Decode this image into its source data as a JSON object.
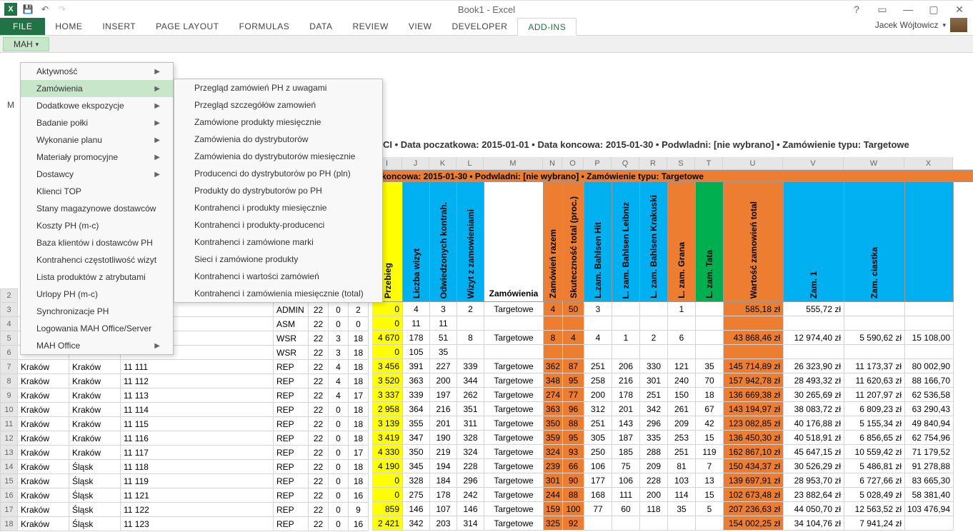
{
  "title": "Book1 - Excel",
  "user": "Jacek Wójtowicz",
  "ribbon": {
    "file": "FILE",
    "tabs": [
      "HOME",
      "INSERT",
      "PAGE LAYOUT",
      "FORMULAS",
      "DATA",
      "REVIEW",
      "VIEW",
      "DEVELOPER",
      "ADD-INS"
    ],
    "active": "ADD-INS"
  },
  "mah_btn": "MAH",
  "m_label": "M",
  "menu1": [
    {
      "label": "Aktywność",
      "arrow": true
    },
    {
      "label": "Zamówienia",
      "arrow": true,
      "hl": true
    },
    {
      "label": "Dodatkowe ekspozycje",
      "arrow": true
    },
    {
      "label": "Badanie połki",
      "arrow": true
    },
    {
      "label": "Wykonanie planu",
      "arrow": true
    },
    {
      "label": "Materiały promocyjne",
      "arrow": true
    },
    {
      "label": "Dostawcy",
      "arrow": true
    },
    {
      "label": "Klienci TOP",
      "arrow": false
    },
    {
      "label": "Stany magazynowe dostawców",
      "arrow": false
    },
    {
      "label": "Koszty PH (m-c)",
      "arrow": false
    },
    {
      "label": "Baza klientów i dostawców PH",
      "arrow": false
    },
    {
      "label": "Kontrahenci częstotliwość wizyt",
      "arrow": false
    },
    {
      "label": "Lista produktów z atrybutami",
      "arrow": false
    },
    {
      "label": "Urlopy PH (m-c)",
      "arrow": false
    },
    {
      "label": "Synchronizacje PH",
      "arrow": false
    },
    {
      "label": "Logowania MAH Office/Server",
      "arrow": false
    },
    {
      "label": "MAH Office",
      "arrow": true
    }
  ],
  "menu2": [
    "Przegląd zamówień PH z uwagami",
    "Przegląd szczegółów zamowień",
    "Zamówione produkty miesięcznie",
    "Zamówienia do dystrybutorów",
    "Zamówienia do dystrybutorów miesięcznie",
    "Producenci do dystrybutorów po PH (pln)",
    "Produkty do dystrybutorów po PH",
    "Kontrahenci i  produkty miesięcznie",
    "Kontrahenci i produkty-producenci",
    "Kontrahenci i zamówione marki",
    "Sieci i zamówione produkty",
    "Kontrahenci i wartości zamówień",
    "Kontrahenci i zamówienia miesięcznie (total)"
  ],
  "info_row": "CI • Data poczatkowa: 2015-01-01 • Data koncowa: 2015-01-30 • Podwladni: [nie wybrano] • Zamówienie typu: Targetowe",
  "banner": "a koncowa: 2015-01-30 • Podwladni: [nie wybrano] • Zamówienie typu: Targetowe",
  "col_letters": [
    "I",
    "J",
    "K",
    "L",
    "M",
    "N",
    "O",
    "P",
    "Q",
    "R",
    "S",
    "T",
    "U",
    "V",
    "W",
    "X"
  ],
  "col_letter_widths": [
    43,
    38,
    38,
    38,
    83,
    27,
    30,
    39,
    39,
    39,
    39,
    39,
    84,
    85,
    85,
    68
  ],
  "row_nums": [
    "2",
    "3",
    "4",
    "5",
    "6",
    "7",
    "8",
    "9",
    "10",
    "11",
    "12",
    "13",
    "14",
    "15",
    "16",
    "17",
    "18"
  ],
  "hdr_cols": [
    {
      "label": "Przebieg",
      "cls": "w-prz",
      "vert": true
    },
    {
      "label": "Liczba wizyt",
      "cls": "w-lw",
      "vert": true
    },
    {
      "label": "Odwiedzonych kontrah.",
      "cls": "w-ok",
      "vert": true
    },
    {
      "label": "Wizyt z zamowieniami",
      "cls": "w-wz",
      "vert": true
    },
    {
      "label": "Zamówienia",
      "cls": "w-zam",
      "vert": false
    },
    {
      "label": "Zamówień razem",
      "cls": "w-zr",
      "vert": true
    },
    {
      "label": "Skuteczność total (proc.)",
      "cls": "w-sk",
      "vert": true
    },
    {
      "label": "L.zam. Bahlsen Hit",
      "cls": "w-bh",
      "vert": true
    },
    {
      "label": "L. zam. Bahlsen Leibniz",
      "cls": "w-bl",
      "vert": true
    },
    {
      "label": "L. zam. Bahlsen Krakuski",
      "cls": "w-bk",
      "vert": true
    },
    {
      "label": "L. zam. Grana",
      "cls": "w-gr",
      "vert": true
    },
    {
      "label": "L. zam. Tata",
      "cls": "w-ta",
      "vert": true
    },
    {
      "label": "Wartość zamowień total",
      "cls": "w-wt",
      "vert": true
    },
    {
      "label": "Zam. 1",
      "cls": "w-z1",
      "vert": true
    },
    {
      "label": "Zam. ciastka",
      "cls": "w-z2",
      "vert": true
    },
    {
      "label": "",
      "cls": "w-z3",
      "vert": false
    }
  ],
  "rows": [
    {
      "reg": "",
      "sub": "",
      "zip": "",
      "role": "ADMIN",
      "a": "22",
      "b": "0",
      "c": "2",
      "prz": "0",
      "lw": "4",
      "ok": "3",
      "wz": "2",
      "zam": "Targetowe",
      "zr": "4",
      "sk": "50",
      "bh": "3",
      "bl": "",
      "bk": "",
      "gr": "1",
      "ta": "",
      "wt": "585,18 zł",
      "z1": "555,72 zł",
      "z2": "",
      "z3": ""
    },
    {
      "reg": "",
      "sub": "",
      "zip": "",
      "role": "ASM",
      "a": "22",
      "b": "0",
      "c": "0",
      "prz": "0",
      "lw": "11",
      "ok": "11",
      "wz": "",
      "zam": "",
      "zr": "",
      "sk": "",
      "bh": "",
      "bl": "",
      "bk": "",
      "gr": "",
      "ta": "",
      "wt": "",
      "z1": "",
      "z2": "",
      "z3": ""
    },
    {
      "reg": "",
      "sub": "",
      "zip": "",
      "role": "WSR",
      "a": "22",
      "b": "3",
      "c": "18",
      "prz": "4 670",
      "lw": "178",
      "ok": "51",
      "wz": "8",
      "zam": "Targetowe",
      "zr": "8",
      "sk": "4",
      "bh": "4",
      "bl": "1",
      "bk": "2",
      "gr": "6",
      "ta": "",
      "wt": "43 868,46 zł",
      "z1": "12 974,40 zł",
      "z2": "5 590,62 zł",
      "z3": "15 108,00"
    },
    {
      "reg": "",
      "sub": "",
      "zip": "",
      "role": "WSR",
      "a": "22",
      "b": "3",
      "c": "18",
      "prz": "0",
      "lw": "105",
      "ok": "35",
      "wz": "",
      "zam": "",
      "zr": "",
      "sk": "",
      "bh": "",
      "bl": "",
      "bk": "",
      "gr": "",
      "ta": "",
      "wt": "",
      "z1": "",
      "z2": "",
      "z3": ""
    },
    {
      "reg": "Kraków",
      "sub": "Kraków",
      "zip": "11 111",
      "role": "REP",
      "a": "22",
      "b": "4",
      "c": "18",
      "prz": "3 456",
      "lw": "391",
      "ok": "227",
      "wz": "339",
      "zam": "Targetowe",
      "zr": "362",
      "sk": "87",
      "bh": "251",
      "bl": "206",
      "bk": "330",
      "gr": "121",
      "ta": "35",
      "wt": "145 714,89 zł",
      "z1": "26 323,90 zł",
      "z2": "11 173,37 zł",
      "z3": "80 002,90"
    },
    {
      "reg": "Kraków",
      "sub": "Kraków",
      "zip": "11 112",
      "role": "REP",
      "a": "22",
      "b": "4",
      "c": "18",
      "prz": "3 520",
      "lw": "363",
      "ok": "200",
      "wz": "344",
      "zam": "Targetowe",
      "zr": "348",
      "sk": "95",
      "bh": "258",
      "bl": "216",
      "bk": "301",
      "gr": "240",
      "ta": "70",
      "wt": "157 942,78 zł",
      "z1": "28 493,32 zł",
      "z2": "11 620,63 zł",
      "z3": "88 166,70"
    },
    {
      "reg": "Kraków",
      "sub": "Kraków",
      "zip": "11 113",
      "role": "REP",
      "a": "22",
      "b": "4",
      "c": "17",
      "prz": "3 337",
      "lw": "339",
      "ok": "197",
      "wz": "262",
      "zam": "Targetowe",
      "zr": "274",
      "sk": "77",
      "bh": "200",
      "bl": "178",
      "bk": "251",
      "gr": "150",
      "ta": "18",
      "wt": "136 669,38 zł",
      "z1": "30 265,69 zł",
      "z2": "11 207,97 zł",
      "z3": "62 536,58"
    },
    {
      "reg": "Kraków",
      "sub": "Kraków",
      "zip": "11 114",
      "role": "REP",
      "a": "22",
      "b": "0",
      "c": "18",
      "prz": "2 958",
      "lw": "364",
      "ok": "216",
      "wz": "351",
      "zam": "Targetowe",
      "zr": "363",
      "sk": "96",
      "bh": "312",
      "bl": "201",
      "bk": "342",
      "gr": "261",
      "ta": "67",
      "wt": "143 194,97 zł",
      "z1": "38 083,72 zł",
      "z2": "6 809,23 zł",
      "z3": "63 290,43"
    },
    {
      "reg": "Kraków",
      "sub": "Kraków",
      "zip": "11 115",
      "role": "REP",
      "a": "22",
      "b": "0",
      "c": "18",
      "prz": "3 139",
      "lw": "355",
      "ok": "201",
      "wz": "311",
      "zam": "Targetowe",
      "zr": "350",
      "sk": "88",
      "bh": "251",
      "bl": "143",
      "bk": "296",
      "gr": "209",
      "ta": "42",
      "wt": "123 082,85 zł",
      "z1": "40 176,88 zł",
      "z2": "5 155,34 zł",
      "z3": "49 840,94"
    },
    {
      "reg": "Kraków",
      "sub": "Kraków",
      "zip": "11 116",
      "role": "REP",
      "a": "22",
      "b": "0",
      "c": "18",
      "prz": "3 419",
      "lw": "347",
      "ok": "190",
      "wz": "328",
      "zam": "Targetowe",
      "zr": "359",
      "sk": "95",
      "bh": "305",
      "bl": "187",
      "bk": "335",
      "gr": "253",
      "ta": "15",
      "wt": "136 450,30 zł",
      "z1": "40 518,91 zł",
      "z2": "6 856,65 zł",
      "z3": "62 754,96"
    },
    {
      "reg": "Kraków",
      "sub": "Kraków",
      "zip": "11 117",
      "role": "REP",
      "a": "22",
      "b": "0",
      "c": "17",
      "prz": "4 330",
      "lw": "350",
      "ok": "219",
      "wz": "324",
      "zam": "Targetowe",
      "zr": "324",
      "sk": "93",
      "bh": "250",
      "bl": "185",
      "bk": "288",
      "gr": "251",
      "ta": "119",
      "wt": "162 867,10 zł",
      "z1": "45 647,15 zł",
      "z2": "10 559,42 zł",
      "z3": "71 179,52"
    },
    {
      "reg": "Kraków",
      "sub": "Śląsk",
      "zip": "11 118",
      "role": "REP",
      "a": "22",
      "b": "0",
      "c": "18",
      "prz": "4 190",
      "lw": "345",
      "ok": "194",
      "wz": "228",
      "zam": "Targetowe",
      "zr": "239",
      "sk": "66",
      "bh": "106",
      "bl": "75",
      "bk": "209",
      "gr": "81",
      "ta": "7",
      "wt": "150 434,37 zł",
      "z1": "30 526,29 zł",
      "z2": "5 486,81 zł",
      "z3": "91 278,88"
    },
    {
      "reg": "Kraków",
      "sub": "Śląsk",
      "zip": "11 119",
      "role": "REP",
      "a": "22",
      "b": "0",
      "c": "18",
      "prz": "0",
      "lw": "328",
      "ok": "184",
      "wz": "296",
      "zam": "Targetowe",
      "zr": "301",
      "sk": "90",
      "bh": "177",
      "bl": "106",
      "bk": "228",
      "gr": "103",
      "ta": "13",
      "wt": "139 697,91 zł",
      "z1": "28 953,70 zł",
      "z2": "6 727,66 zł",
      "z3": "83 665,30"
    },
    {
      "reg": "Kraków",
      "sub": "Śląsk",
      "zip": "11 121",
      "role": "REP",
      "a": "22",
      "b": "0",
      "c": "16",
      "prz": "0",
      "lw": "275",
      "ok": "178",
      "wz": "242",
      "zam": "Targetowe",
      "zr": "244",
      "sk": "88",
      "bh": "168",
      "bl": "111",
      "bk": "200",
      "gr": "114",
      "ta": "15",
      "wt": "102 673,48 zł",
      "z1": "23 882,64 zł",
      "z2": "5 028,49 zł",
      "z3": "58 381,40"
    },
    {
      "reg": "Kraków",
      "sub": "Śląsk",
      "zip": "11 122",
      "role": "REP",
      "a": "22",
      "b": "0",
      "c": "9",
      "prz": "859",
      "lw": "146",
      "ok": "107",
      "wz": "146",
      "zam": "Targetowe",
      "zr": "159",
      "sk": "100",
      "bh": "77",
      "bl": "60",
      "bk": "118",
      "gr": "35",
      "ta": "5",
      "wt": "207 236,63 zł",
      "z1": "44 050,70 zł",
      "z2": "12 563,52 zł",
      "z3": "103 476,94"
    },
    {
      "reg": "Kraków",
      "sub": "Śląsk",
      "zip": "11 123",
      "role": "REP",
      "a": "22",
      "b": "0",
      "c": "16",
      "prz": "2 421",
      "lw": "342",
      "ok": "203",
      "wz": "314",
      "zam": "Targetowe",
      "zr": "325",
      "sk": "92",
      "bh": "",
      "bl": "",
      "bk": "",
      "gr": "",
      "ta": "",
      "wt": "154 002,25 zł",
      "z1": "34 104,76 zł",
      "z2": "7 941,24 zł",
      "z3": ""
    }
  ]
}
